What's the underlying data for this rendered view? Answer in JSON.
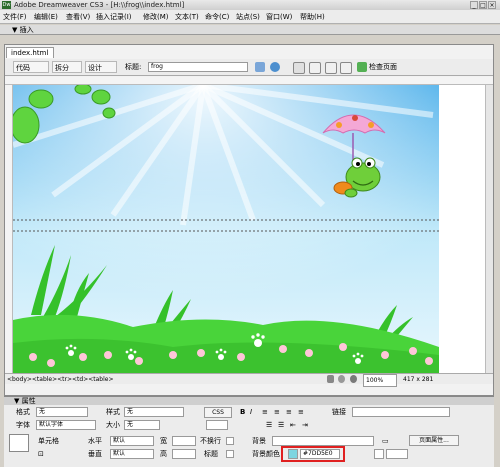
{
  "window": {
    "title": "Adobe Dreamweaver CS3 - [H:\\\\frog\\\\index.html]"
  },
  "menu": [
    "文件(F)",
    "编辑(E)",
    "查看(V)",
    "插入记录(I)",
    "修改(M)",
    "文本(T)",
    "命令(C)",
    "站点(S)",
    "窗口(W)",
    "帮助(H)"
  ],
  "insert_bar": {
    "label": "▼ 插入"
  },
  "document": {
    "tab": "index.html *",
    "toolbar": {
      "code": "代码",
      "split": "拆分",
      "design": "设计",
      "title_label": "标题:",
      "title_value": "frog",
      "check_page": "检查页面"
    },
    "status": {
      "tags": "<body><table><tr><td><table>",
      "zoom": "100%",
      "size": "417 x 281"
    }
  },
  "properties": {
    "header": "▼ 属性",
    "format_label": "格式",
    "format_value": "无",
    "style_label": "样式",
    "style_value": "无",
    "css_label": "CSS",
    "link_label": "链接",
    "font_label": "字体",
    "font_value": "默认字体",
    "size_label": "大小",
    "size_value": "无",
    "cell_label": "单元格",
    "horz_label": "水平",
    "horz_value": "默认",
    "vert_label": "垂直",
    "vert_value": "默认",
    "w_label": "宽",
    "h_label": "高",
    "nowrap_label": "不换行",
    "header_label": "标题",
    "bg_label": "背景",
    "bgcolor_label": "背景颜色",
    "bgcolor_value": "#7DD5E0",
    "page_props": "页面属性..."
  },
  "colors": {
    "sky_top": "#3aa7e8",
    "sky_bottom": "#e8f7fd",
    "grass": "#49d43a",
    "highlight": "#e02020"
  }
}
